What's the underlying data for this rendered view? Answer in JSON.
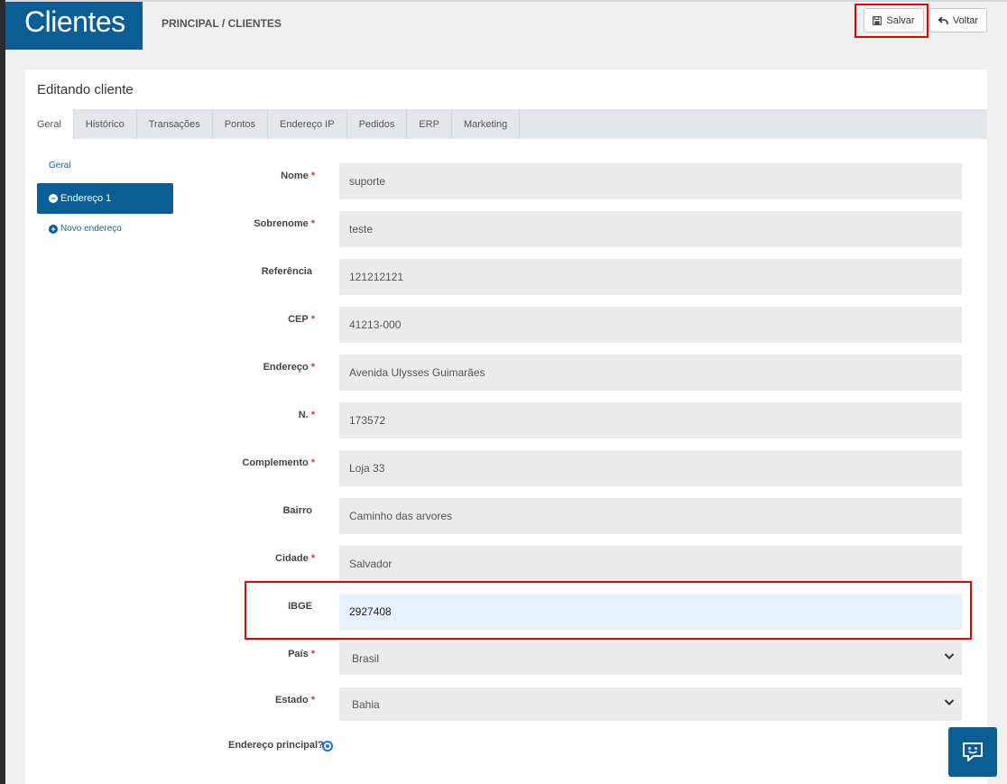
{
  "app": {
    "title": "Clientes"
  },
  "breadcrumb": {
    "text": "PRINCIPAL / CLIENTES"
  },
  "toolbar": {
    "save_label": "Salvar",
    "back_label": "Voltar"
  },
  "panel": {
    "title": "Editando cliente"
  },
  "tabs": [
    {
      "label": "Geral",
      "active": true
    },
    {
      "label": "Histórico"
    },
    {
      "label": "Transações"
    },
    {
      "label": "Pontos"
    },
    {
      "label": "Endereço IP"
    },
    {
      "label": "Pedidos"
    },
    {
      "label": "ERP"
    },
    {
      "label": "Marketing"
    }
  ],
  "sidebar": {
    "geral_label": "Geral",
    "active_label": "Endereço 1",
    "new_label": "Novo endereço"
  },
  "form": {
    "fields": [
      {
        "label": "Nome",
        "required": "*",
        "value": "suporte"
      },
      {
        "label": "Sobrenome",
        "required": "*",
        "value": "teste"
      },
      {
        "label": "Referência",
        "required": "",
        "value": "121212121"
      },
      {
        "label": "CEP",
        "required": "*",
        "value": "41213-000"
      },
      {
        "label": "Endereço",
        "required": "*",
        "value": "Avenida Ulysses Guimarães"
      },
      {
        "label": "N.",
        "required": "*",
        "value": "173572"
      },
      {
        "label": "Complemento",
        "required": "*",
        "value": "Loja 33"
      },
      {
        "label": "Bairro",
        "required": "",
        "value": "Caminho das arvores"
      },
      {
        "label": "Cidade",
        "required": "*",
        "value": "Salvador"
      },
      {
        "label": "IBGE",
        "required": "",
        "value": "2927408"
      }
    ],
    "pais": {
      "label": "País",
      "required": "*",
      "value": "Brasil"
    },
    "estado": {
      "label": "Estado",
      "required": "*",
      "value": "Bahia"
    },
    "principal": {
      "label": "Endereço principal?"
    }
  },
  "colors": {
    "brand": "#0b5e95",
    "highlight": "#e00000",
    "focus_bg": "#e8f0fe"
  },
  "icons": [
    "save-icon",
    "undo-icon",
    "minus-circle-icon",
    "plus-circle-icon",
    "chevron-down-icon",
    "chat-icon"
  ]
}
